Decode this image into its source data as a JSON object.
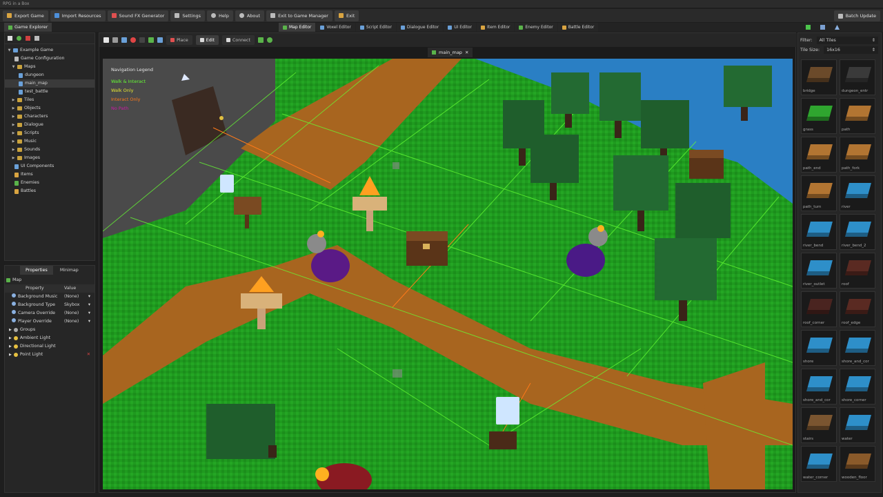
{
  "window_title": "RPG in a Box",
  "menu": {
    "export_game": "Export Game",
    "import_resources": "Import Resources",
    "sound_fx": "Sound FX Generator",
    "settings": "Settings",
    "help": "Help",
    "about": "About",
    "exit_manager": "Exit to Game Manager",
    "exit": "Exit",
    "batch_update": "Batch Update"
  },
  "panel_tab": "Game Explorer",
  "editor_tabs": [
    "Map Editor",
    "Voxel Editor",
    "Script Editor",
    "Dialogue Editor",
    "UI Editor",
    "Item Editor",
    "Enemy Editor",
    "Battle Editor"
  ],
  "tree": {
    "root": "Example Game",
    "game_config": "Game Configuration",
    "maps": "Maps",
    "map_items": [
      "dungeon",
      "main_map",
      "test_battle"
    ],
    "folders": [
      "Tiles",
      "Objects",
      "Characters",
      "Dialogue",
      "Scripts",
      "Music",
      "Sounds",
      "Images"
    ],
    "leaves": [
      "UI Components",
      "Items",
      "Enemies",
      "Battles"
    ]
  },
  "props": {
    "tab_properties": "Properties",
    "tab_minimap": "Minimap",
    "section": "Map",
    "col_property": "Property",
    "col_value": "Value",
    "rows": [
      {
        "label": "Background Music",
        "value": "(None)"
      },
      {
        "label": "Background Type",
        "value": "Skybox"
      },
      {
        "label": "Camera Override",
        "value": "(None)"
      },
      {
        "label": "Player Override",
        "value": "(None)"
      }
    ],
    "groups": [
      "Groups",
      "Ambient Light",
      "Directional Light",
      "Point Light"
    ]
  },
  "toolbar": {
    "place": "Place",
    "edit": "Edit",
    "connect": "Connect"
  },
  "map_tab": "main_map",
  "legend": {
    "title": "Navigation Legend",
    "items": [
      {
        "label": "Walk & Interact",
        "color": "#66ff33"
      },
      {
        "label": "Walk Only",
        "color": "#e6e633"
      },
      {
        "label": "Interact Only",
        "color": "#ff7a1a"
      },
      {
        "label": "No Path",
        "color": "#cc1aa6"
      }
    ]
  },
  "tile_panel": {
    "filter_label": "Filter:",
    "filter_value": "All Tiles",
    "size_label": "Tile Size:",
    "size_value": "16x16",
    "tiles": [
      {
        "name": "bridge",
        "color": "#6b4a2a"
      },
      {
        "name": "dungeon_entr",
        "color": "#3a3a3a"
      },
      {
        "name": "grass",
        "color": "#2fa52f"
      },
      {
        "name": "path",
        "color": "#b27532"
      },
      {
        "name": "path_end",
        "color": "#b27532"
      },
      {
        "name": "path_fork",
        "color": "#b27532"
      },
      {
        "name": "path_turn",
        "color": "#b27532"
      },
      {
        "name": "river",
        "color": "#2e8fc9"
      },
      {
        "name": "river_bend",
        "color": "#2e8fc9"
      },
      {
        "name": "river_bend_2",
        "color": "#2e8fc9"
      },
      {
        "name": "river_outlet",
        "color": "#2e8fc9"
      },
      {
        "name": "roof",
        "color": "#5a2a22"
      },
      {
        "name": "roof_corner",
        "color": "#4a2420"
      },
      {
        "name": "roof_edge",
        "color": "#5a2a22"
      },
      {
        "name": "shore",
        "color": "#2e8fc9"
      },
      {
        "name": "shore_and_cor",
        "color": "#2e8fc9"
      },
      {
        "name": "shore_and_cor",
        "color": "#2e8fc9"
      },
      {
        "name": "shore_corner",
        "color": "#2e8fc9"
      },
      {
        "name": "stairs",
        "color": "#7a5530"
      },
      {
        "name": "water",
        "color": "#2e8fc9"
      },
      {
        "name": "water_corner",
        "color": "#2e8fc9"
      },
      {
        "name": "wooden_floor",
        "color": "#8a5a2a"
      }
    ]
  }
}
